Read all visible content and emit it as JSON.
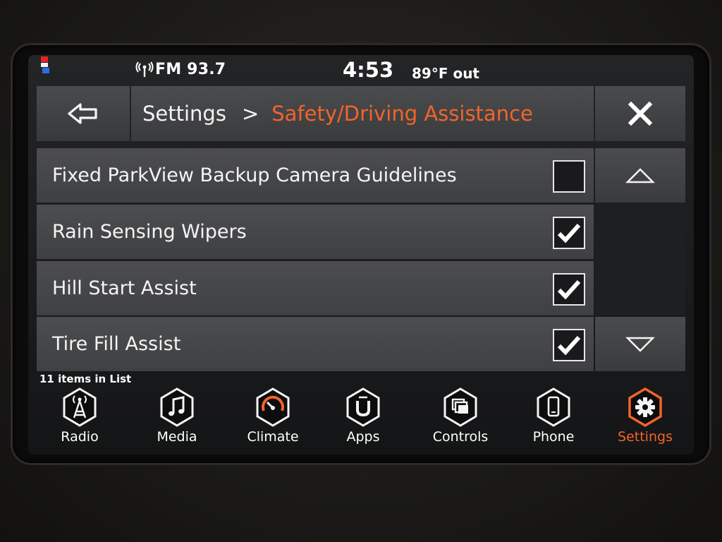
{
  "status": {
    "radio": "FM 93.7",
    "time": "4:53",
    "temperature": "89°F out"
  },
  "header": {
    "breadcrumb_root": "Settings",
    "breadcrumb_separator": ">",
    "breadcrumb_current": "Safety/Driving Assistance"
  },
  "list": {
    "items": [
      {
        "label": "Fixed ParkView Backup Camera Guidelines",
        "checked": false
      },
      {
        "label": "Rain Sensing Wipers",
        "checked": true
      },
      {
        "label": "Hill Start Assist",
        "checked": true
      },
      {
        "label": "Tire Fill Assist",
        "checked": true
      }
    ],
    "count_text": "11 items in List"
  },
  "nav": {
    "items": [
      {
        "label": "Radio",
        "icon": "radio-tower-icon",
        "active": false
      },
      {
        "label": "Media",
        "icon": "music-note-icon",
        "active": false
      },
      {
        "label": "Climate",
        "icon": "climate-dial-icon",
        "active": false
      },
      {
        "label": "Apps",
        "icon": "uconnect-apps-icon",
        "active": false
      },
      {
        "label": "Controls",
        "icon": "controls-icon",
        "active": false
      },
      {
        "label": "Phone",
        "icon": "phone-icon",
        "active": false
      },
      {
        "label": "Settings",
        "icon": "gear-icon",
        "active": true
      }
    ]
  },
  "colors": {
    "accent": "#f2642a",
    "text": "#f4f4f4",
    "row_background": "#46474a"
  }
}
